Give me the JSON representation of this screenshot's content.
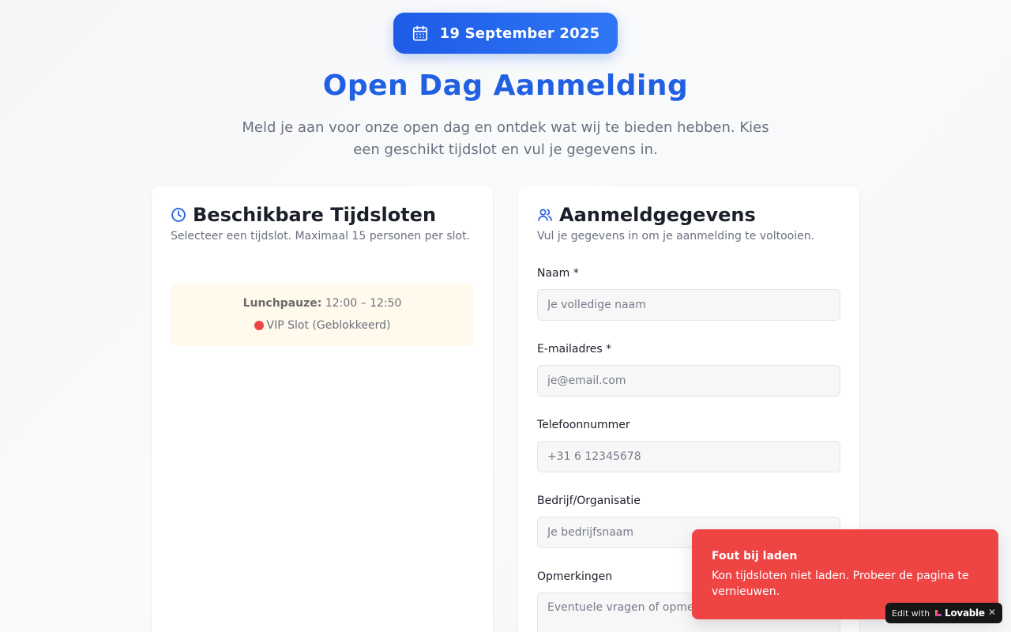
{
  "header": {
    "date": "19 September 2025",
    "title": "Open Dag Aanmelding",
    "subtitle": "Meld je aan voor onze open dag en ontdek wat wij te bieden hebben. Kies een geschikt tijdslot en vul je gegevens in."
  },
  "timeslots": {
    "title": "Beschikbare Tijdsloten",
    "description": "Selecteer een tijdslot. Maximaal 15 personen per slot.",
    "lunch": {
      "label": "Lunchpauze:",
      "time": "12:00 – 12:50",
      "status": "VIP Slot (Geblokkeerd)",
      "status_color": "#ef4444"
    }
  },
  "form": {
    "title": "Aanmeldgegevens",
    "description": "Vul je gegevens in om je aanmelding te voltooien.",
    "fields": {
      "name": {
        "label": "Naam *",
        "placeholder": "Je volledige naam",
        "value": ""
      },
      "email": {
        "label": "E-mailadres *",
        "placeholder": "je@email.com",
        "value": ""
      },
      "phone": {
        "label": "Telefoonnummer",
        "placeholder": "+31 6 12345678",
        "value": ""
      },
      "company": {
        "label": "Bedrijf/Organisatie",
        "placeholder": "Je bedrijfsnaam",
        "value": ""
      },
      "remarks": {
        "label": "Opmerkingen",
        "placeholder": "Eventuele vragen of opmerkingen",
        "value": ""
      }
    }
  },
  "toast": {
    "title": "Fout bij laden",
    "message": "Kon tijdsloten niet laden. Probeer de pagina te vernieuwen.",
    "color": "#ef4444"
  },
  "badge": {
    "edit_with": "Edit with",
    "brand": "Lovable",
    "close": "✕"
  },
  "colors": {
    "accent": "#2160e3",
    "pill_gradient_start": "#1d5be6",
    "pill_gradient_end": "#2f76f5",
    "lunch_bg": "#fffaeb"
  }
}
